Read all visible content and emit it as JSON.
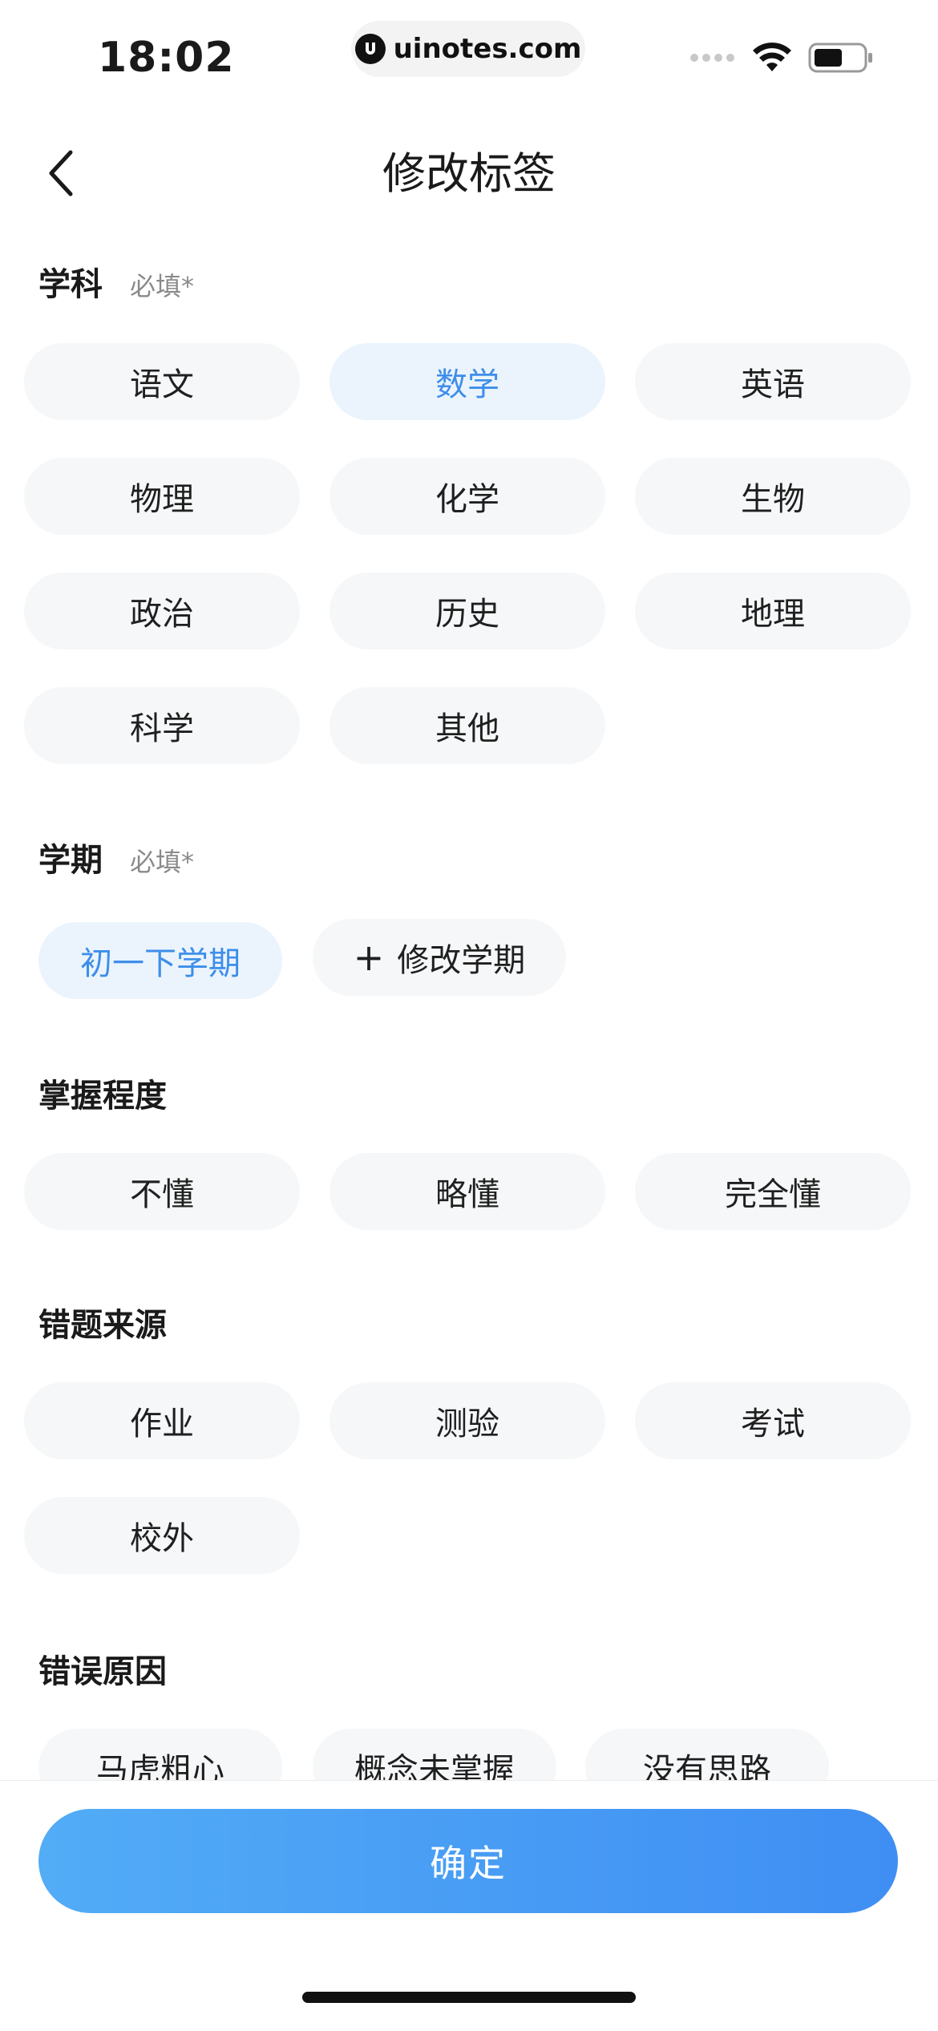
{
  "status_bar": {
    "time": "18:02",
    "url": "uinotes.com"
  },
  "nav": {
    "title": "修改标签"
  },
  "subject": {
    "title": "学科",
    "required": "必填*",
    "options": [
      "语文",
      "数学",
      "英语",
      "物理",
      "化学",
      "生物",
      "政治",
      "历史",
      "地理",
      "科学",
      "其他"
    ],
    "selected": "数学"
  },
  "semester": {
    "title": "学期",
    "required": "必填*",
    "selected_label": "初一下学期",
    "edit_label": "修改学期"
  },
  "mastery": {
    "title": "掌握程度",
    "options": [
      "不懂",
      "略懂",
      "完全懂"
    ]
  },
  "source": {
    "title": "错题来源",
    "options": [
      "作业",
      "测验",
      "考试",
      "校外"
    ]
  },
  "reason": {
    "title": "错误原因",
    "options": [
      "马虎粗心",
      "概念未掌握",
      "没有思路"
    ]
  },
  "footer": {
    "confirm_label": "确定"
  },
  "colors": {
    "accent": "#3e8ee9",
    "chip_bg": "#f5f7f9",
    "chip_selected_bg": "#ebf4fd",
    "button_gradient_start": "#52acf6",
    "button_gradient_end": "#3f8ef3"
  }
}
